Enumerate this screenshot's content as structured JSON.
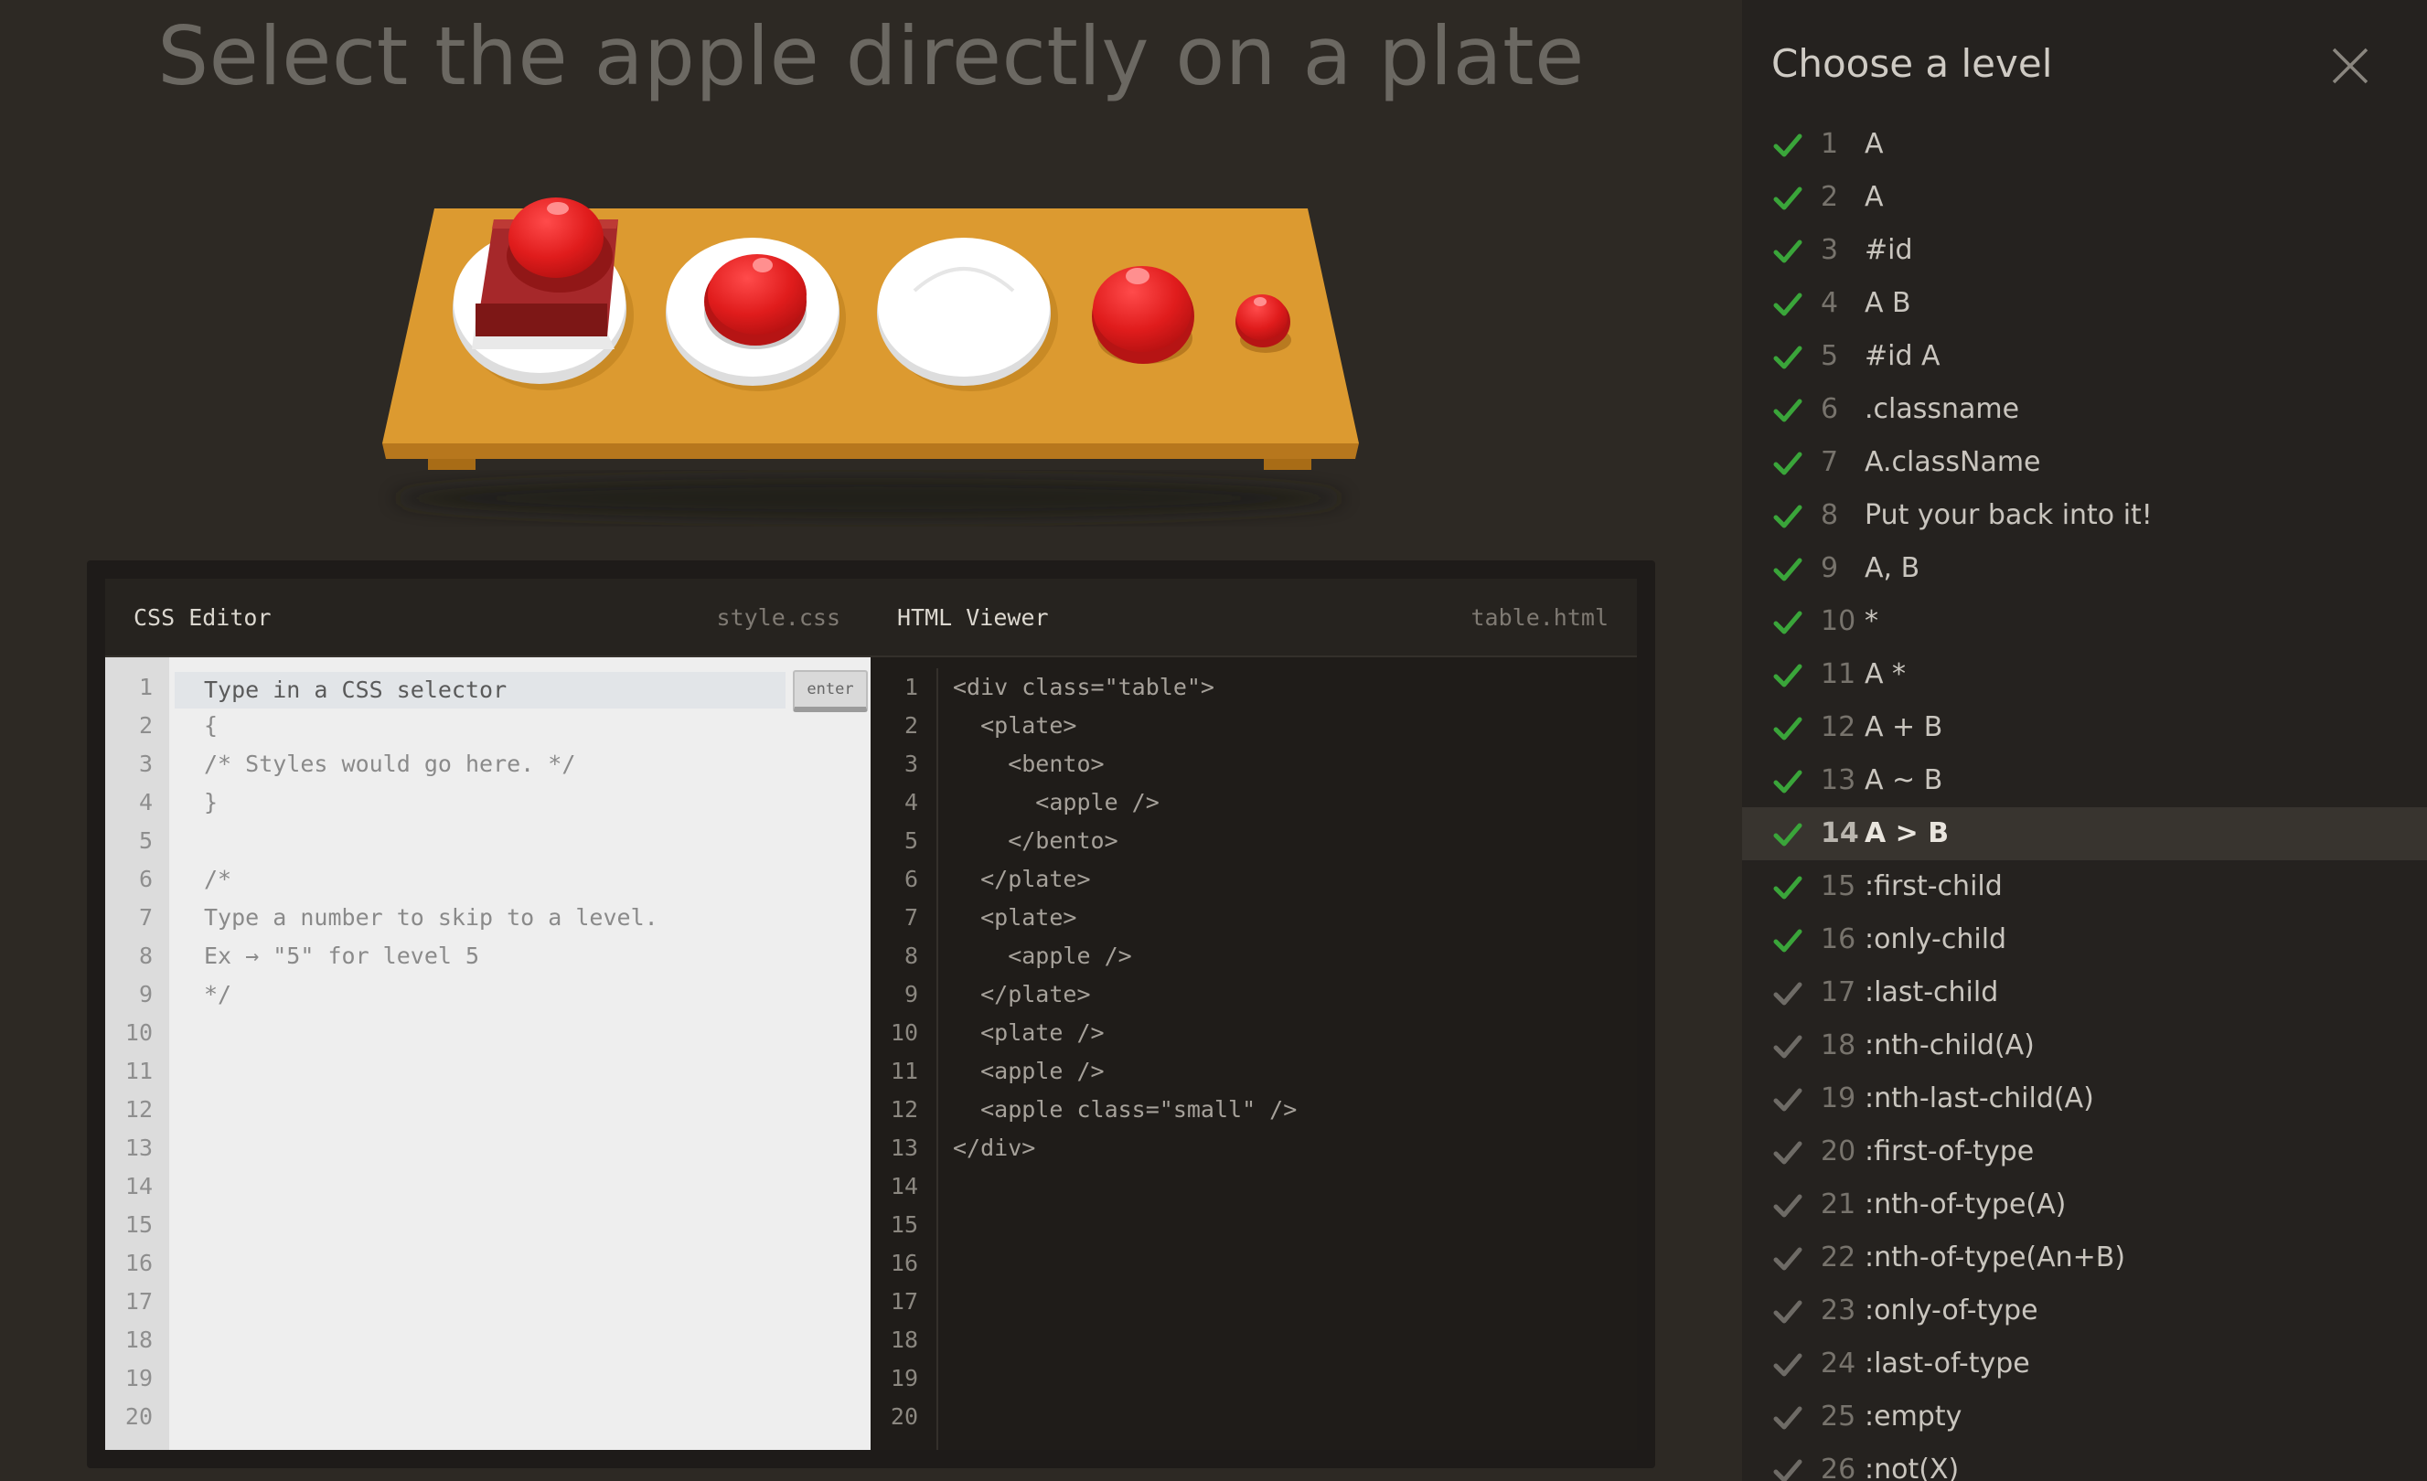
{
  "instruction": "Select the apple directly on a plate",
  "css_editor": {
    "label": "CSS Editor",
    "file": "style.css",
    "placeholder": "Type in a CSS selector",
    "enter_label": "enter",
    "line_numbers": [
      "1",
      "2",
      "3",
      "4",
      "5",
      "6",
      "7",
      "8",
      "9",
      "10",
      "11",
      "12",
      "13",
      "14",
      "15",
      "16",
      "17",
      "18",
      "19",
      "20"
    ],
    "lines": [
      "{",
      "/* Styles would go here. */",
      "}",
      "",
      "/*",
      "Type a number to skip to a level.",
      "Ex → \"5\" for level 5",
      "*/"
    ]
  },
  "html_viewer": {
    "label": "HTML Viewer",
    "file": "table.html",
    "line_numbers": [
      "1",
      "2",
      "3",
      "4",
      "5",
      "6",
      "7",
      "8",
      "9",
      "10",
      "11",
      "12",
      "13",
      "14",
      "15",
      "16",
      "17",
      "18",
      "19",
      "20"
    ],
    "lines": [
      "<div class=\"table\">",
      "  <plate>",
      "    <bento>",
      "      <apple />",
      "    </bento>",
      "  </plate>",
      "  <plate>",
      "    <apple />",
      "  </plate>",
      "  <plate />",
      "  <apple />",
      "  <apple class=\"small\" />",
      "</div>"
    ]
  },
  "sidebar": {
    "title": "Choose a level",
    "current_level": 14,
    "levels": [
      {
        "num": "1",
        "name": "A",
        "done": true
      },
      {
        "num": "2",
        "name": "A",
        "done": true
      },
      {
        "num": "3",
        "name": "#id",
        "done": true
      },
      {
        "num": "4",
        "name": "A  B",
        "done": true
      },
      {
        "num": "5",
        "name": "#id  A",
        "done": true
      },
      {
        "num": "6",
        "name": ".classname",
        "done": true
      },
      {
        "num": "7",
        "name": "A.className",
        "done": true
      },
      {
        "num": "8",
        "name": "Put your back into it!",
        "done": true
      },
      {
        "num": "9",
        "name": "A, B",
        "done": true
      },
      {
        "num": "10",
        "name": "*",
        "done": true
      },
      {
        "num": "11",
        "name": "A  *",
        "done": true
      },
      {
        "num": "12",
        "name": "A + B",
        "done": true
      },
      {
        "num": "13",
        "name": "A ~ B",
        "done": true
      },
      {
        "num": "14",
        "name": "A > B",
        "done": true
      },
      {
        "num": "15",
        "name": ":first-child",
        "done": true
      },
      {
        "num": "16",
        "name": ":only-child",
        "done": true
      },
      {
        "num": "17",
        "name": ":last-child",
        "done": false
      },
      {
        "num": "18",
        "name": ":nth-child(A)",
        "done": false
      },
      {
        "num": "19",
        "name": ":nth-last-child(A)",
        "done": false
      },
      {
        "num": "20",
        "name": ":first-of-type",
        "done": false
      },
      {
        "num": "21",
        "name": ":nth-of-type(A)",
        "done": false
      },
      {
        "num": "22",
        "name": ":nth-of-type(An+B)",
        "done": false
      },
      {
        "num": "23",
        "name": ":only-of-type",
        "done": false
      },
      {
        "num": "24",
        "name": ":last-of-type",
        "done": false
      },
      {
        "num": "25",
        "name": ":empty",
        "done": false
      },
      {
        "num": "26",
        "name": ":not(X)",
        "done": false
      }
    ]
  },
  "colors": {
    "background": "#2d2924",
    "table": "#dc9a30",
    "apple": "#e01c1c",
    "check_done": "#3aa53a",
    "check_pending": "#6e6b66"
  }
}
